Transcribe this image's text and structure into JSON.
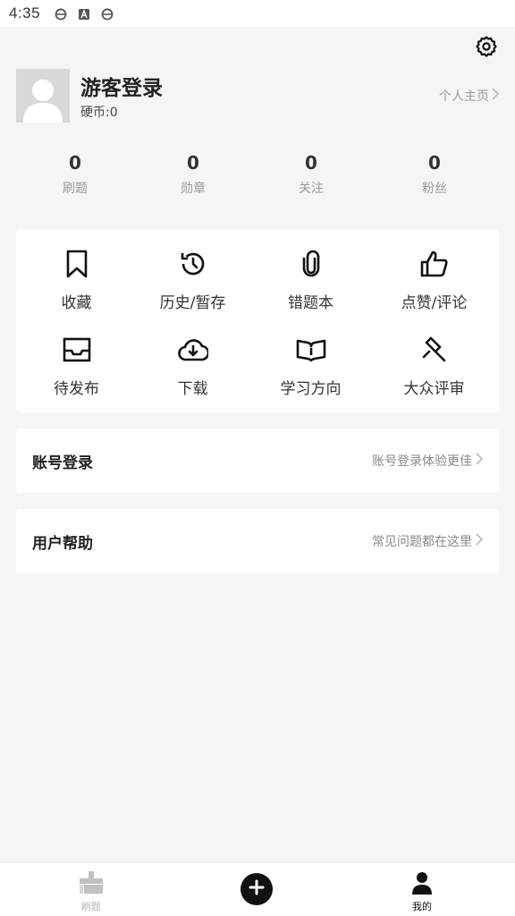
{
  "status_bar": {
    "time": "4:35",
    "icons": [
      "browser-e-icon",
      "text-a-icon",
      "browser-e-icon"
    ]
  },
  "header": {
    "settings_icon": "gear-icon"
  },
  "profile": {
    "name": "游客登录",
    "coins": "硬币:0",
    "homepage_link": "个人主页"
  },
  "stats": [
    {
      "value": "0",
      "label": "刷题"
    },
    {
      "value": "0",
      "label": "勋章"
    },
    {
      "value": "0",
      "label": "关注"
    },
    {
      "value": "0",
      "label": "粉丝"
    }
  ],
  "grid": [
    {
      "label": "收藏",
      "icon": "bookmark-icon"
    },
    {
      "label": "历史/暂存",
      "icon": "history-icon"
    },
    {
      "label": "错题本",
      "icon": "paperclip-icon"
    },
    {
      "label": "点赞/评论",
      "icon": "thumbs-up-icon"
    },
    {
      "label": "待发布",
      "icon": "inbox-icon"
    },
    {
      "label": "下载",
      "icon": "cloud-download-icon"
    },
    {
      "label": "学习方向",
      "icon": "open-book-icon"
    },
    {
      "label": "大众评审",
      "icon": "gavel-icon"
    }
  ],
  "account_row": {
    "title": "账号登录",
    "hint": "账号登录体验更佳"
  },
  "help_row": {
    "title": "用户帮助",
    "hint": "常见问题都在这里"
  },
  "bottom_nav": {
    "items": [
      {
        "label": "刷题",
        "icon": "practice-icon",
        "active": false
      },
      {
        "label": "",
        "icon": "add-icon",
        "active": false
      },
      {
        "label": "我的",
        "icon": "person-icon",
        "active": true
      }
    ]
  },
  "colors": {
    "background": "#f5f5f5",
    "card": "#ffffff",
    "text_primary": "#222222",
    "text_secondary": "#999999",
    "nav_inactive": "#b5b5b5",
    "nav_active": "#111111"
  }
}
